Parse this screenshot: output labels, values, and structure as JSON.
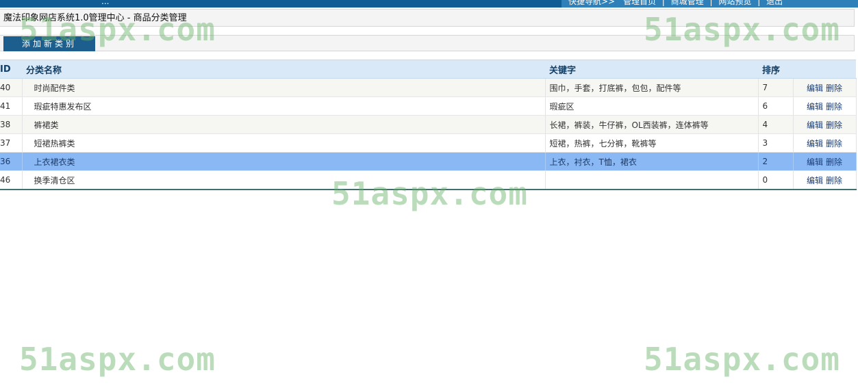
{
  "topbar": {
    "left_stub": "...",
    "quicknav": [
      "快捷导航>>",
      "管理首页",
      "商城管理",
      "网站预览",
      "退出"
    ],
    "separator": "|"
  },
  "breadcrumb": "魔法印象网店系统1.0管理中心 - 商品分类管理",
  "actions": {
    "add_label": "添加新类别"
  },
  "table": {
    "headers": {
      "id": "ID",
      "name": "分类名称",
      "keywords": "关键字",
      "sort": "排序"
    },
    "rows": [
      {
        "id": "40",
        "name": "时尚配件类",
        "keywords": "围巾，手套，打底裤，包包，配件等",
        "sort": "7",
        "edit": "编辑",
        "delete": "删除"
      },
      {
        "id": "41",
        "name": "瑕疵特惠发布区",
        "keywords": "瑕疵区",
        "sort": "6",
        "edit": "编辑",
        "delete": "删除"
      },
      {
        "id": "38",
        "name": "裤裙类",
        "keywords": "长裙，裤装，牛仔裤，OL西装裤，连体裤等",
        "sort": "4",
        "edit": "编辑",
        "delete": "删除"
      },
      {
        "id": "37",
        "name": "短裙热裤类",
        "keywords": "短裙，热裤，七分裤，靴裤等",
        "sort": "3",
        "edit": "编辑",
        "delete": "删除"
      },
      {
        "id": "36",
        "name": "上衣裙衣类",
        "keywords": "上衣，衬衣，T恤，裙衣",
        "sort": "2",
        "edit": "编辑",
        "delete": "删除"
      },
      {
        "id": "46",
        "name": "换季清仓区",
        "keywords": "",
        "sort": "0",
        "edit": "编辑",
        "delete": "删除"
      }
    ],
    "selected_row": 4
  },
  "watermark": "51aspx.com"
}
